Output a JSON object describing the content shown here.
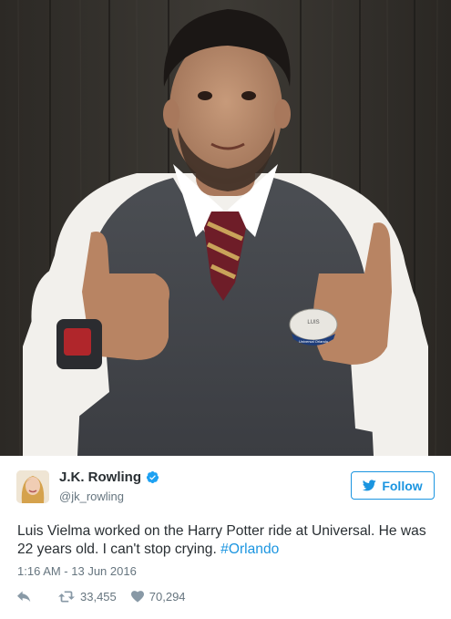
{
  "photo": {
    "badge_text": "LUIS",
    "badge_subtext": "Universal Orlando"
  },
  "tweet": {
    "author_name": "J.K. Rowling",
    "author_handle": "@jk_rowling",
    "follow_label": "Follow",
    "text_main": "Luis Vielma worked on the Harry Potter ride at Universal. He was 22 years old. I can't stop crying. ",
    "hashtag": "#Orlando",
    "timestamp": "1:16 AM - 13 Jun 2016",
    "retweet_count": "33,455",
    "like_count": "70,294"
  },
  "icons": {
    "verified": "verified-badge-icon",
    "follow": "twitter-bird-icon",
    "reply": "reply-icon",
    "retweet": "retweet-icon",
    "like": "heart-icon"
  },
  "colors": {
    "accent": "#1b95e0",
    "text": "#292f33",
    "muted": "#66757f",
    "icon": "#8899a6"
  }
}
